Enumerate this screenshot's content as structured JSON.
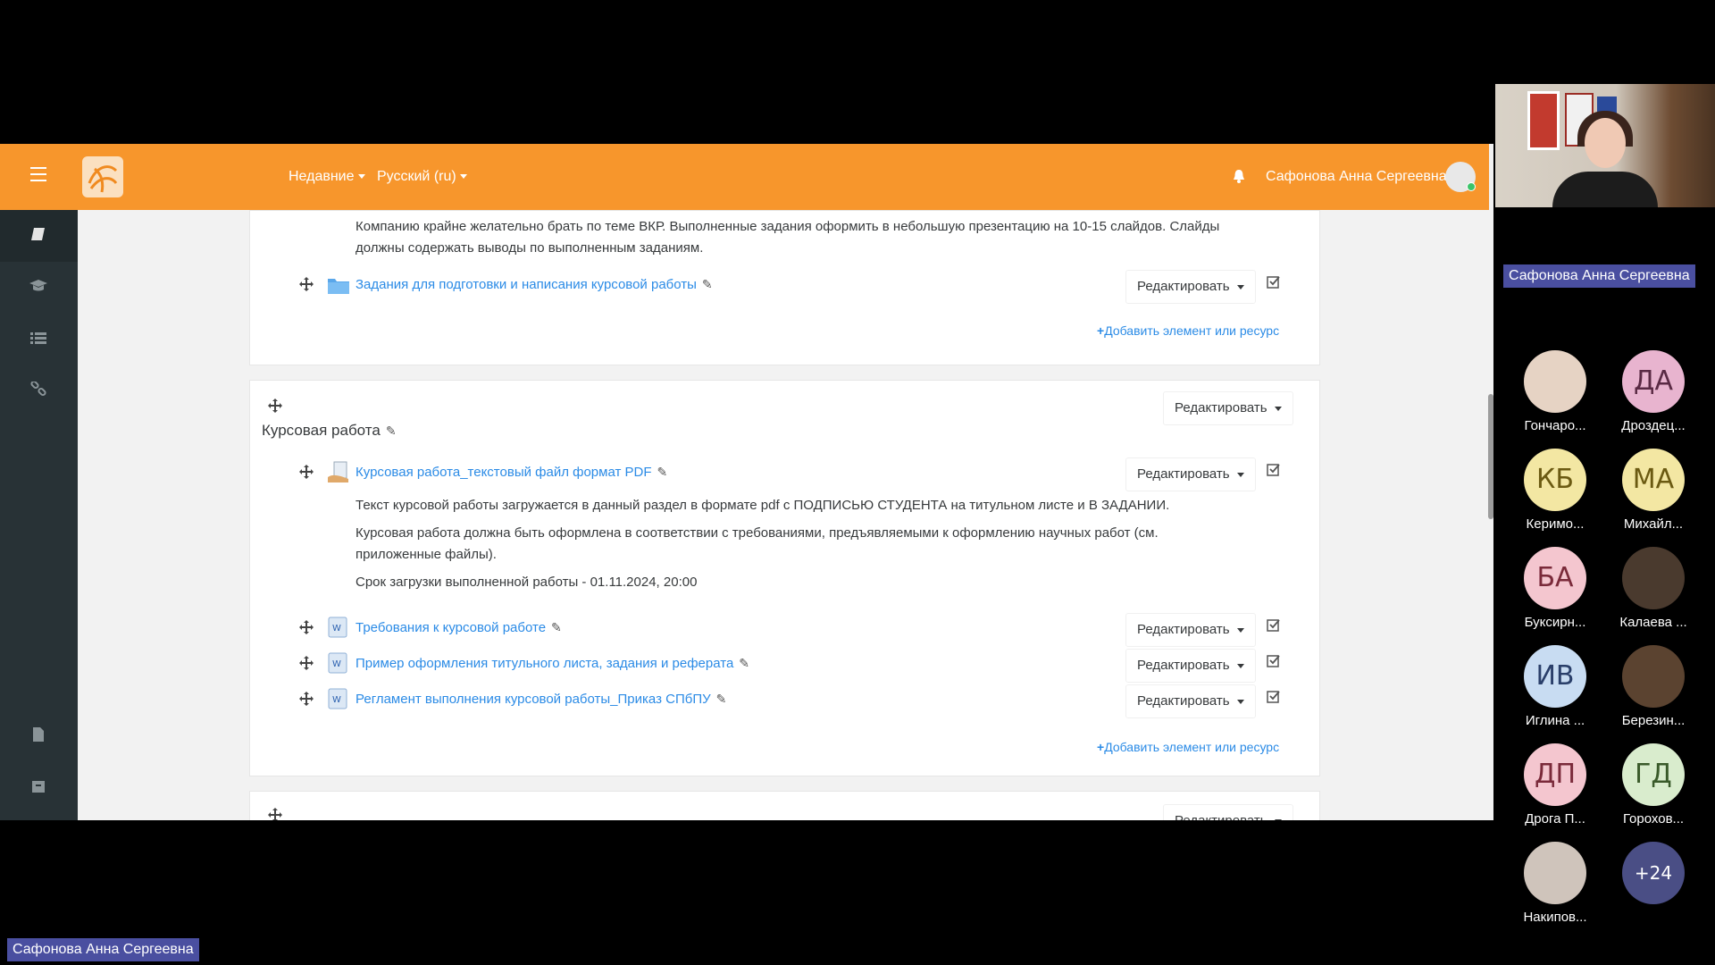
{
  "topbar": {
    "recent": "Недавние",
    "language": "Русский (ru)",
    "user": "Сафонова Анна Сергеевна"
  },
  "section1": {
    "text_line1": "Компанию крайне желательно брать по теме ВКР. Выполненные задания оформить в небольшую презентацию на 10-15 слайдов. Слайды",
    "text_line2": "должны содержать выводы по выполненным заданиям.",
    "folder_link": "Задания для подготовки и написания курсовой работы",
    "edit": "Редактировать",
    "add_resource": "Добавить элемент или ресурс"
  },
  "section2": {
    "title": "Курсовая работа",
    "edit": "Редактировать",
    "assign_link": "Курсовая работа_текстовый файл формат PDF",
    "desc1": "Текст курсовой работы загружается в данный раздел в формате pdf с ПОДПИСЬЮ СТУДЕНТА на титульном листе и  В ЗАДАНИИ.",
    "desc2a": "Курсовая работа должна быть оформлена в соответствии с требованиями, предъявляемыми к оформлению научных работ (см.",
    "desc2b": "приложенные файлы).",
    "deadline": "Срок загрузки выполненной работы - 01.11.2024, 20:00",
    "files": [
      {
        "label": "Требования к курсовой работе"
      },
      {
        "label": "Пример оформления титульного листа, задания и реферата"
      },
      {
        "label": "Регламент выполнения курсовой работы_Приказ СПбПУ"
      }
    ],
    "add_resource": "Добавить элемент или ресурс"
  },
  "section3": {
    "edit_partial": "Редактировать"
  },
  "video": {
    "presenter_label": "Сафонова Анна Сергеевна",
    "bottom_label": "Сафонова Анна Сергеевна",
    "participants": [
      {
        "initials": "",
        "name": "Гончаро...",
        "color": "#e6d3c4"
      },
      {
        "initials": "ДА",
        "name": "Дроздец...",
        "color": "#e8b4cf",
        "text": "#5a2a44"
      },
      {
        "initials": "КБ",
        "name": "Керимо...",
        "color": "#f3e7a3",
        "text": "#6b5a12"
      },
      {
        "initials": "МА",
        "name": "Михайл...",
        "color": "#f3e7a3",
        "text": "#6b5a12"
      },
      {
        "initials": "БА",
        "name": "Буксирн...",
        "color": "#f4c6cf",
        "text": "#7a2a3a"
      },
      {
        "initials": "",
        "name": "Калаева ...",
        "color": "#4a3a2e"
      },
      {
        "initials": "ИВ",
        "name": "Иглина ...",
        "color": "#c8dcf2",
        "text": "#2a3f6a"
      },
      {
        "initials": "",
        "name": "Березин...",
        "color": "#5b4330"
      },
      {
        "initials": "ДП",
        "name": "Дрога П...",
        "color": "#f4c6cf",
        "text": "#7a2a3a"
      },
      {
        "initials": "ГД",
        "name": "Горохов...",
        "color": "#d9eccd",
        "text": "#3a5a2a"
      },
      {
        "initials": "",
        "name": "Накипов...",
        "color": "#cfc4bb"
      },
      {
        "initials": "+24",
        "name": "",
        "color": "#4a4e85",
        "text": "#ffffff"
      }
    ]
  }
}
